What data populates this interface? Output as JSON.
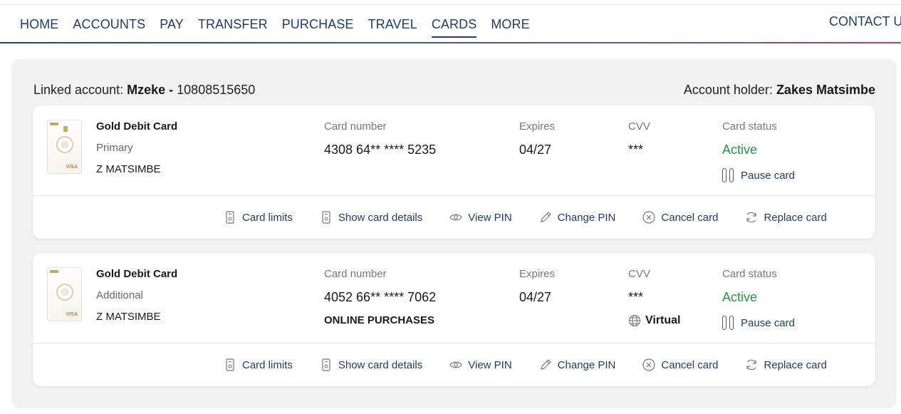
{
  "nav": {
    "items": [
      "HOME",
      "ACCOUNTS",
      "PAY",
      "TRANSFER",
      "PURCHASE",
      "TRAVEL",
      "CARDS",
      "MORE"
    ],
    "active": "CARDS",
    "contact": "CONTACT US"
  },
  "account": {
    "linked_label": "Linked account:",
    "linked_name": "Mzeke -",
    "linked_number": "10808515650",
    "holder_label": "Account holder:",
    "holder_name": "Zakes Matsimbe"
  },
  "labels": {
    "card_number": "Card number",
    "expires": "Expires",
    "cvv": "CVV",
    "card_status": "Card status",
    "pause": "Pause card"
  },
  "actions": {
    "limits": "Card limits",
    "details": "Show card details",
    "view_pin": "View PIN",
    "change_pin": "Change PIN",
    "cancel": "Cancel card",
    "replace": "Replace card"
  },
  "cards": [
    {
      "title": "Gold Debit Card",
      "type": "Primary",
      "name": "Z MATSIMBE",
      "number": "4308 64** **** 5235",
      "expires": "04/27",
      "cvv": "***",
      "status": "Active",
      "extra": "",
      "virtual": ""
    },
    {
      "title": "Gold Debit Card",
      "type": "Additional",
      "name": "Z MATSIMBE",
      "number": "4052 66** **** 7062",
      "expires": "04/27",
      "cvv": "***",
      "status": "Active",
      "extra": "ONLINE PURCHASES",
      "virtual": "Virtual"
    }
  ],
  "colors": {
    "nav": "#1d3d6e",
    "active_status": "#1f9a3d",
    "panel": "#f2f2f2"
  }
}
